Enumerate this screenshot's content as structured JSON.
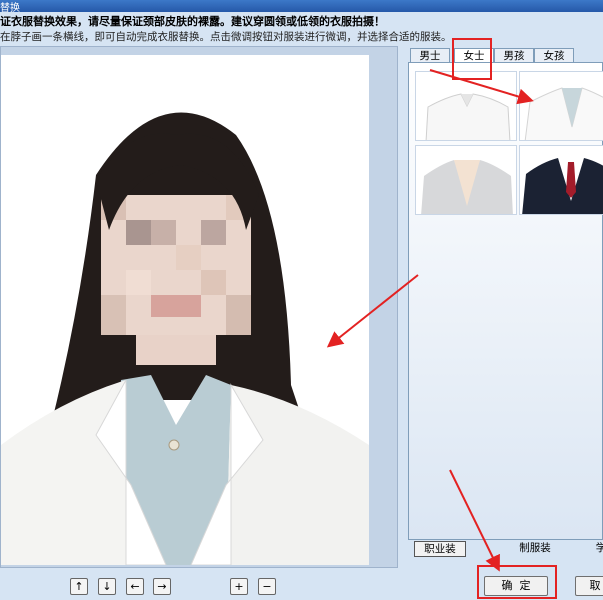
{
  "window": {
    "title": "替换"
  },
  "notice": {
    "line1": "证衣服替换效果，请尽量保证颈部皮肤的裸露。建议穿圆领或低领的衣服拍摄！",
    "line2": "在脖子画一条横线，即可自动完成衣服替换。点击微调按钮对服装进行微调，并选择合适的服装。"
  },
  "tabs": [
    "男士",
    "女士",
    "男孩",
    "女孩"
  ],
  "active_tab": "女士",
  "clothes": [
    {
      "name": "white-shirt"
    },
    {
      "name": "white-blazer"
    },
    {
      "name": "grey-blazer"
    },
    {
      "name": "navy-suit"
    }
  ],
  "categories": [
    "职业装",
    "制服装",
    "学"
  ],
  "buttons": {
    "ok": "确  定",
    "cancel": "取"
  },
  "nav_buttons": [
    "up-arrow-icon",
    "down-arrow-icon",
    "left-arrow-icon",
    "right-arrow-icon",
    "zoom-in-icon",
    "zoom-out-icon"
  ],
  "colors": {
    "highlight": "#e32222",
    "panel": "#d6e4f3",
    "title": "#2558a8"
  }
}
